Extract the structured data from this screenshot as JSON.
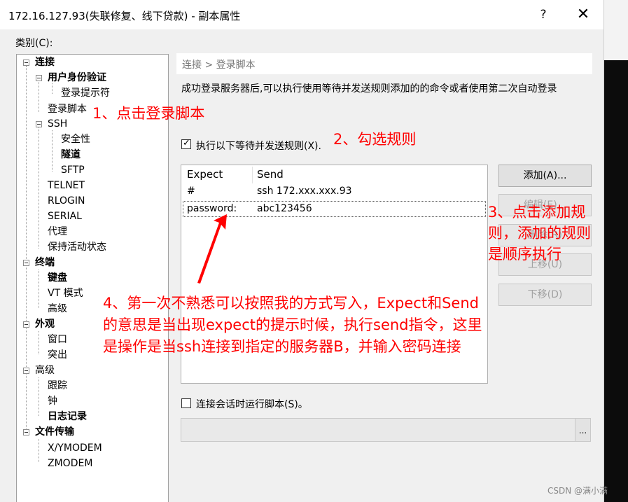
{
  "window": {
    "title": "172.16.127.93(失联修复、线下贷款) - 副本属性",
    "help_label": "?",
    "close_label": "✕"
  },
  "category_label": "类别(C):",
  "tree": [
    {
      "label": "连接",
      "bold": true
    },
    {
      "label": "用户身份验证",
      "bold": true
    },
    {
      "label": "登录提示符",
      "bold": false
    },
    {
      "label": "登录脚本",
      "bold": false
    },
    {
      "label": "SSH",
      "bold": false
    },
    {
      "label": "安全性",
      "bold": false
    },
    {
      "label": "隧道",
      "bold": true
    },
    {
      "label": "SFTP",
      "bold": false
    },
    {
      "label": "TELNET",
      "bold": false
    },
    {
      "label": "RLOGIN",
      "bold": false
    },
    {
      "label": "SERIAL",
      "bold": false
    },
    {
      "label": "代理",
      "bold": false
    },
    {
      "label": "保持活动状态",
      "bold": false
    },
    {
      "label": "终端",
      "bold": true
    },
    {
      "label": "键盘",
      "bold": true
    },
    {
      "label": "VT 模式",
      "bold": false
    },
    {
      "label": "高级",
      "bold": false
    },
    {
      "label": "外观",
      "bold": true
    },
    {
      "label": "窗口",
      "bold": false
    },
    {
      "label": "突出",
      "bold": false
    },
    {
      "label": "高级",
      "bold": false
    },
    {
      "label": "跟踪",
      "bold": false
    },
    {
      "label": "钟",
      "bold": false
    },
    {
      "label": "日志记录",
      "bold": true
    },
    {
      "label": "文件传输",
      "bold": true
    },
    {
      "label": "X/YMODEM",
      "bold": false
    },
    {
      "label": "ZMODEM",
      "bold": false
    }
  ],
  "breadcrumb": "连接 > 登录脚本",
  "description": "成功登录服务器后,可以执行使用等待并发送规则添加的的命令或者使用第二次自动登录",
  "rules_checkbox": {
    "label": "执行以下等待并发送规则(X).",
    "checked": true
  },
  "rules_table": {
    "headers": [
      "Expect",
      "Send"
    ],
    "rows": [
      {
        "expect": "#",
        "send": "ssh 172.xxx.xxx.93"
      },
      {
        "expect": "password:",
        "send": "abc123456"
      }
    ]
  },
  "buttons": {
    "add": "添加(A)...",
    "edit": "编辑(E)...",
    "remove": "删除(R)",
    "move_up": "上移(U)",
    "move_down": "下移(D)"
  },
  "script_checkbox": {
    "label": "连接会话时运行脚本(S)。",
    "checked": false
  },
  "script_path": "",
  "browse_label": "...",
  "annotations": {
    "step1": "1、点击登录脚本",
    "step2": "2、勾选规则",
    "step3": "3、点击添加规\n则，添加的规则\n是顺序执行",
    "step4": "4、第一次不熟悉可以按照我的方式写入，Expect和Send\n的意思是当出现expect的提示时候，执行send指令，这里\n是操作是当ssh连接到指定的服务器B，并输入密码连接"
  },
  "watermark": "CSDN @满小满",
  "colors": {
    "annotation": "#ff0000",
    "dialog_bg": "#f0f0f0"
  }
}
